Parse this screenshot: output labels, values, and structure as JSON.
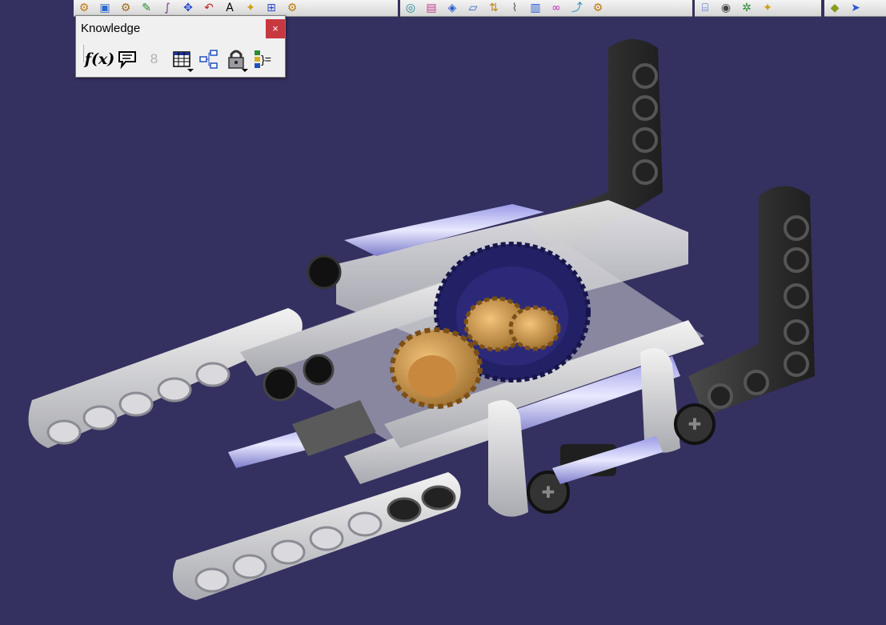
{
  "toolbar_top": {
    "groups": [
      {
        "icons": [
          "gear-icon",
          "image-icon",
          "gear-icon",
          "edit-icon",
          "curve-icon",
          "move-icon",
          "undo-icon",
          "text-icon",
          "lamp-icon",
          "relation-icon",
          "gear-icon"
        ]
      },
      {
        "icons": [
          "catalog-icon",
          "box-icon",
          "parts-icon",
          "plane-icon",
          "arrows-icon",
          "paperclip-icon",
          "document-icon",
          "link-icon",
          "wand-icon",
          "gear-icon"
        ]
      },
      {
        "icons": [
          "cylinder-icon",
          "camera-icon",
          "pose-icon",
          "lamp-icon"
        ]
      },
      {
        "icons": [
          "cube-icon",
          "sweep-icon"
        ]
      }
    ]
  },
  "knowledge_toolbar": {
    "title": "Knowledge",
    "close_label": "×",
    "icons": [
      {
        "name": "formula-icon",
        "glyph": "f(x)",
        "dropdown": false
      },
      {
        "name": "comment-icon",
        "glyph": "💬",
        "dropdown": false
      },
      {
        "name": "chain-icon",
        "glyph": "8",
        "dropdown": false
      },
      {
        "name": "table-icon",
        "glyph": "▦",
        "dropdown": true
      },
      {
        "name": "parameters-tree-icon",
        "glyph": "⊞",
        "dropdown": false
      },
      {
        "name": "lock-icon",
        "glyph": "🔒",
        "dropdown": true
      },
      {
        "name": "equivalent-icon",
        "glyph": "}=",
        "dropdown": false
      }
    ]
  },
  "viewport": {
    "background_color": "#34305f",
    "model": "lego-gearbox-assembly"
  }
}
